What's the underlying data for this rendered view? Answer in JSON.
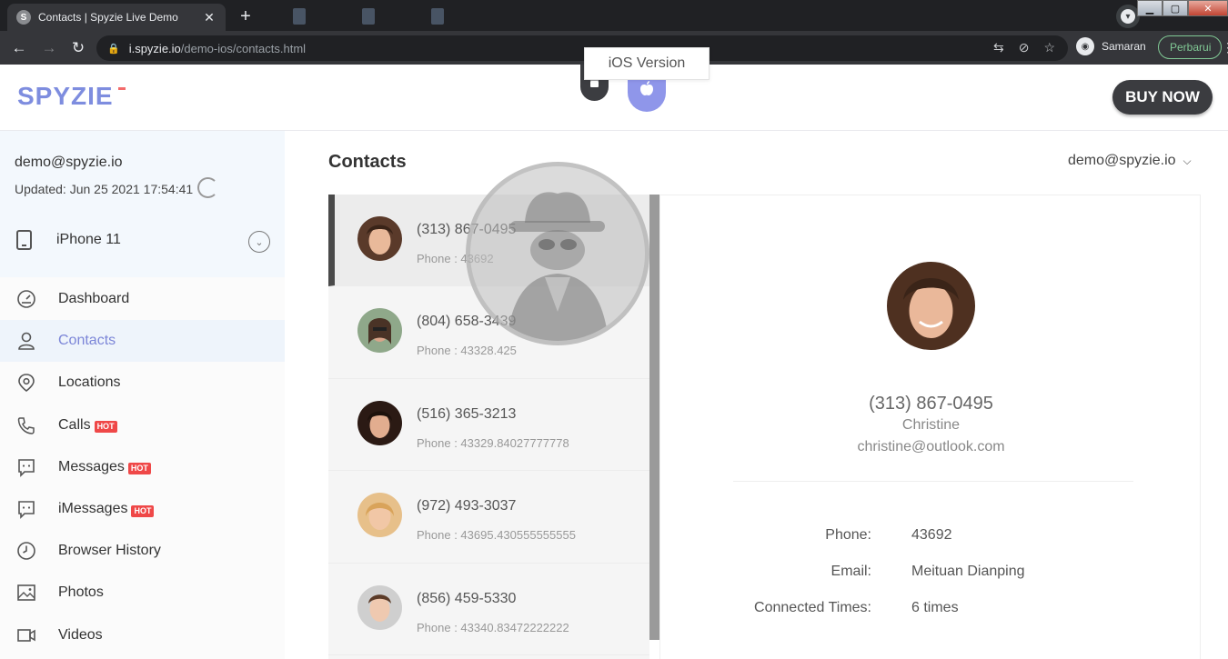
{
  "browser": {
    "tab_title": "Contacts | Spyzie Live Demo",
    "favicon_letter": "S",
    "url_host": "i.spyzie.io",
    "url_path": "/demo-ios/contacts.html",
    "profile_label": "Samaran",
    "update_label": "Perbarui"
  },
  "header": {
    "logo_text": "SPYZIE",
    "os_tooltip": "iOS Version",
    "buy_now": "BUY NOW",
    "accent_color": "#8f96ea"
  },
  "sidebar": {
    "account_email": "demo@spyzie.io",
    "updated_text": "Updated: Jun 25 2021 17:54:41",
    "device_name": "iPhone 11",
    "items": [
      {
        "label": "Dashboard",
        "icon": "dashboard-icon"
      },
      {
        "label": "Contacts",
        "icon": "contacts-icon",
        "active": true
      },
      {
        "label": "Locations",
        "icon": "location-pin-icon"
      },
      {
        "label": "Calls",
        "icon": "phone-call-icon",
        "badge": "HOT"
      },
      {
        "label": "Messages",
        "icon": "message-icon",
        "badge": "HOT"
      },
      {
        "label": "iMessages",
        "icon": "imessage-icon",
        "badge": "HOT"
      },
      {
        "label": "Browser History",
        "icon": "clock-icon"
      },
      {
        "label": "Photos",
        "icon": "photo-icon"
      },
      {
        "label": "Videos",
        "icon": "video-icon"
      }
    ]
  },
  "main": {
    "title": "Contacts",
    "user_menu": "demo@spyzie.io",
    "contacts": [
      {
        "phone": "(313) 867-0495",
        "sub": "Phone : 43692",
        "selected": true
      },
      {
        "phone": "(804) 658-3439",
        "sub": "Phone : 43328.425"
      },
      {
        "phone": "(516) 365-3213",
        "sub": "Phone : 43329.84027777778"
      },
      {
        "phone": "(972) 493-3037",
        "sub": "Phone : 43695.430555555555"
      },
      {
        "phone": "(856) 459-5330",
        "sub": "Phone : 43340.83472222222"
      }
    ],
    "detail": {
      "phone": "(313) 867-0495",
      "name": "Christine",
      "email": "christine@outlook.com",
      "fields": [
        {
          "label": "Phone:",
          "value": "43692"
        },
        {
          "label": "Email:",
          "value": "Meituan Dianping"
        },
        {
          "label": "Connected Times:",
          "value": "6 times"
        }
      ]
    }
  }
}
